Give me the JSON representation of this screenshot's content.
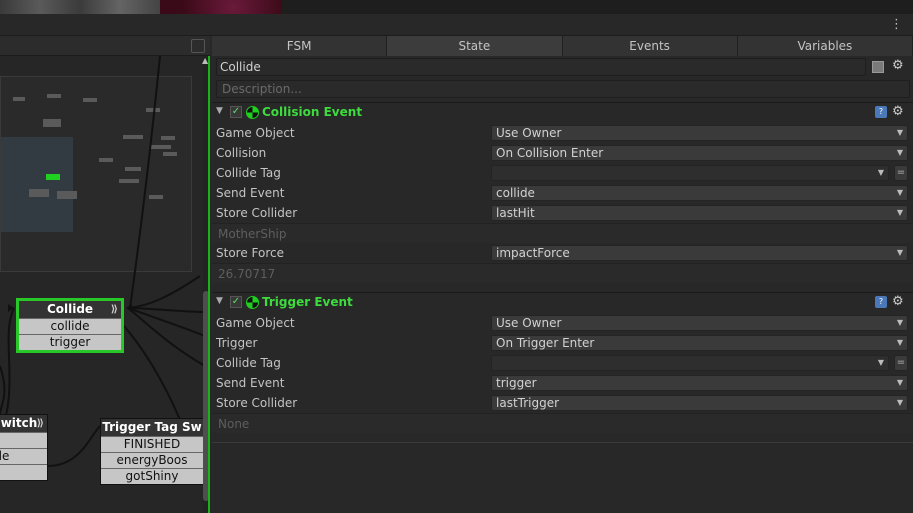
{
  "window": {
    "menu_icon": "kebab-menu-icon"
  },
  "graph": {
    "nodes": {
      "collide": {
        "title": "Collide",
        "rows": [
          "collide",
          "trigger"
        ]
      },
      "switch": {
        "title": "witch",
        "rows": [
          "",
          "ide",
          "D"
        ]
      },
      "trigger_tag": {
        "title": "Trigger Tag Sw",
        "rows": [
          "FINISHED",
          "energyBoos",
          "gotShiny"
        ]
      }
    }
  },
  "inspector": {
    "tabs": [
      "FSM",
      "State",
      "Events",
      "Variables"
    ],
    "active_tab": "State",
    "state_name": "Collide",
    "description_placeholder": "Description...",
    "actions": [
      {
        "title": "Collision Event",
        "props": [
          {
            "label": "Game Object",
            "value": "Use Owner"
          },
          {
            "label": "Collision",
            "value": "On Collision Enter"
          },
          {
            "label": "Collide Tag",
            "value": ""
          },
          {
            "label": "Send Event",
            "value": "collide"
          },
          {
            "label": "Store Collider",
            "value": "lastHit"
          },
          {
            "result": "MotherShip"
          },
          {
            "label": "Store Force",
            "value": "impactForce"
          },
          {
            "result": "26.70717"
          }
        ]
      },
      {
        "title": "Trigger Event",
        "props": [
          {
            "label": "Game Object",
            "value": "Use Owner"
          },
          {
            "label": "Trigger",
            "value": "On Trigger Enter"
          },
          {
            "label": "Collide Tag",
            "value": ""
          },
          {
            "label": "Send Event",
            "value": "trigger"
          },
          {
            "label": "Store Collider",
            "value": "lastTrigger"
          },
          {
            "result": "None"
          }
        ]
      }
    ]
  },
  "colors": {
    "accent_green": "#3ddb3d",
    "selection_border": "#28c828"
  }
}
